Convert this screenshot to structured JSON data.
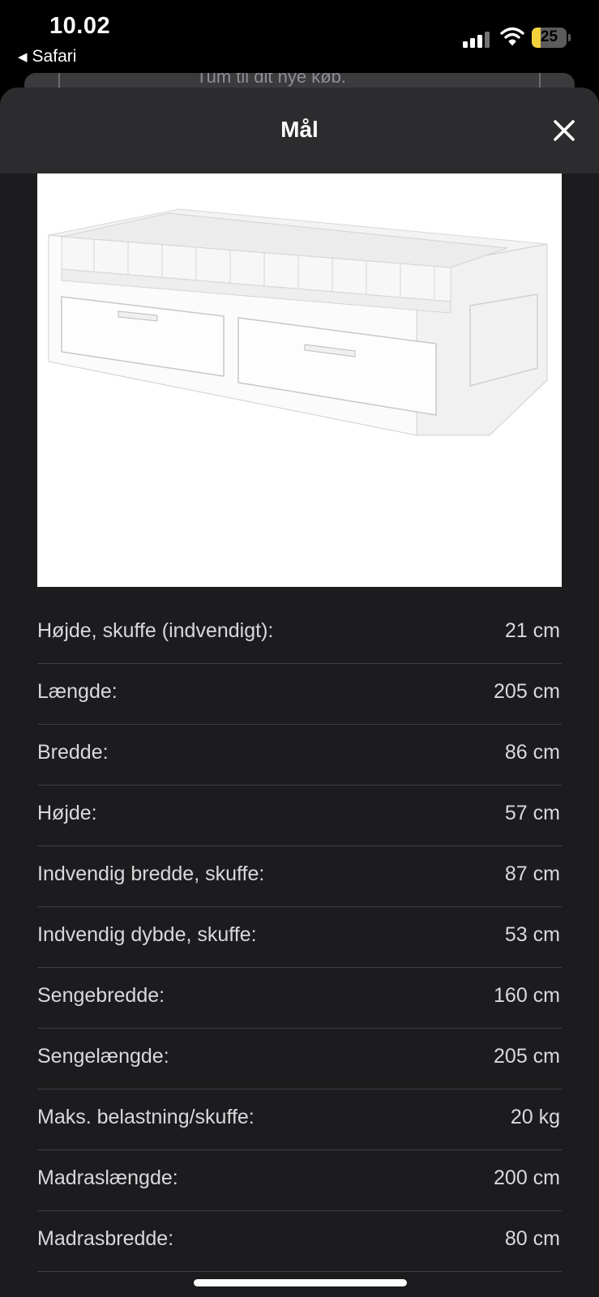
{
  "status_bar": {
    "time": "10.02",
    "back_app": "Safari",
    "battery_percent": "25",
    "battery_level": 0.25,
    "battery_color": "#f2d23c"
  },
  "background_page": {
    "partial_text": "Tum til dit nye køb."
  },
  "sheet": {
    "title": "Mål",
    "close_icon": "close-icon",
    "product_image": "white day-bed with two drawers and mattress"
  },
  "dimensions": [
    {
      "label": "Højde, skuffe (indvendigt):",
      "value": "21 cm"
    },
    {
      "label": "Længde:",
      "value": "205 cm"
    },
    {
      "label": "Bredde:",
      "value": "86 cm"
    },
    {
      "label": "Højde:",
      "value": "57 cm"
    },
    {
      "label": "Indvendig bredde, skuffe:",
      "value": "87 cm"
    },
    {
      "label": "Indvendig dybde, skuffe:",
      "value": "53 cm"
    },
    {
      "label": "Sengebredde:",
      "value": "160 cm"
    },
    {
      "label": "Sengelængde:",
      "value": "205 cm"
    },
    {
      "label": "Maks.  belastning/skuffe:",
      "value": "20 kg"
    },
    {
      "label": "Madraslængde:",
      "value": "200 cm"
    },
    {
      "label": "Madrasbredde:",
      "value": "80 cm"
    }
  ]
}
